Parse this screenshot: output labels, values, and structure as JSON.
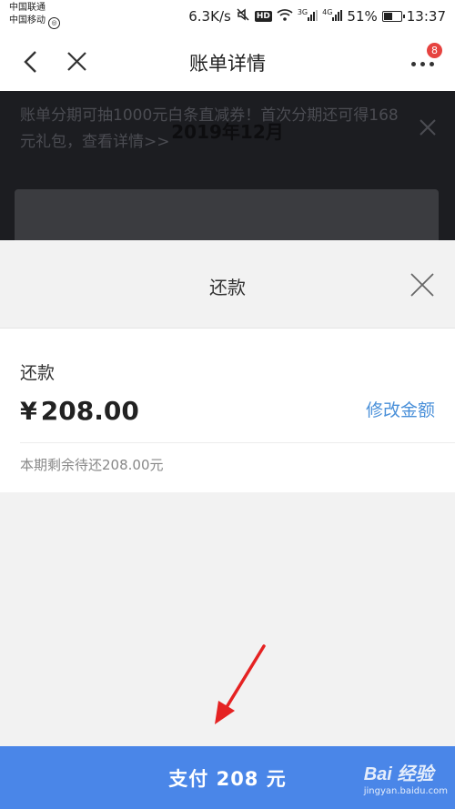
{
  "status_bar": {
    "carrier_1": "中国联通",
    "carrier_2": "中国移动",
    "network_speed": "6.3K/s",
    "hd_label": "HD",
    "signal_1_type": "3G",
    "signal_2_type": "4G",
    "battery": "51%",
    "time": "13:37"
  },
  "nav": {
    "title": "账单详情",
    "back_icon": "chevron-left-icon",
    "close_icon": "close-icon",
    "more_icon": "more-dots-icon",
    "notification_count": "8"
  },
  "background": {
    "promo_text": "账单分期可抽1000元白条直减券！首次分期还可得168元礼包，查看详情>>",
    "month": "2019年12月"
  },
  "sheet": {
    "title": "还款",
    "repay_label": "还款",
    "currency_symbol": "¥",
    "amount": "208.00",
    "edit_amount_link": "修改金额",
    "remaining_note": "本期剩余待还208.00元"
  },
  "pay_button": {
    "label": "支付 208 元"
  },
  "watermark": {
    "brand": "Bai 经验",
    "url": "jingyan.baidu.com"
  },
  "colors": {
    "accent_blue": "#4a86e8",
    "link_blue": "#4a90d9",
    "badge_red": "#e64340",
    "arrow_red": "#e52222"
  }
}
